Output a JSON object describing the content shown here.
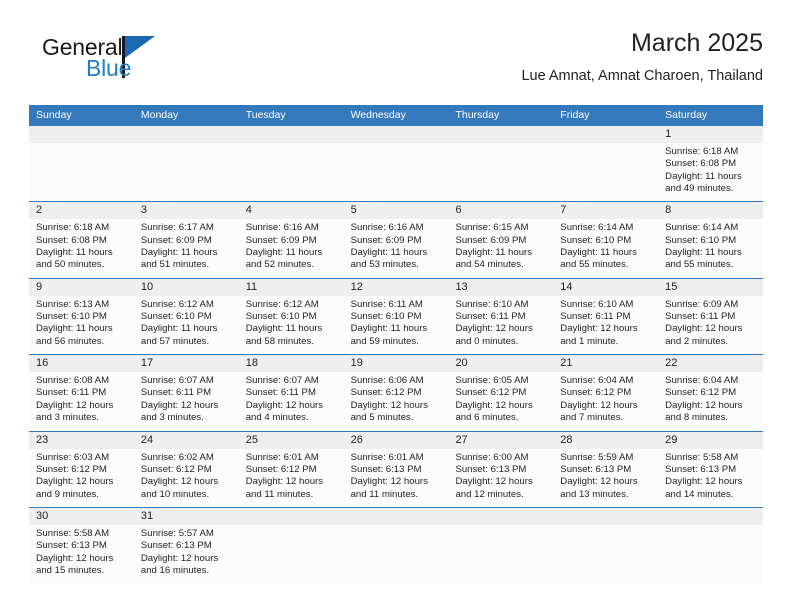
{
  "brand": {
    "name_top": "General",
    "name_bottom": "Blue",
    "accent_color": "#1f7fc4"
  },
  "header": {
    "title": "March 2025",
    "subtitle": "Lue Amnat, Amnat Charoen, Thailand"
  },
  "calendar": {
    "header_bg": "#3579bd",
    "date_band_bg": "#efefef",
    "weekdays": [
      "Sunday",
      "Monday",
      "Tuesday",
      "Wednesday",
      "Thursday",
      "Friday",
      "Saturday"
    ],
    "weeks": [
      [
        {
          "day": "",
          "lines": []
        },
        {
          "day": "",
          "lines": []
        },
        {
          "day": "",
          "lines": []
        },
        {
          "day": "",
          "lines": []
        },
        {
          "day": "",
          "lines": []
        },
        {
          "day": "",
          "lines": []
        },
        {
          "day": "1",
          "lines": [
            "Sunrise: 6:18 AM",
            "Sunset: 6:08 PM",
            "Daylight: 11 hours",
            "and 49 minutes."
          ]
        }
      ],
      [
        {
          "day": "2",
          "lines": [
            "Sunrise: 6:18 AM",
            "Sunset: 6:08 PM",
            "Daylight: 11 hours",
            "and 50 minutes."
          ]
        },
        {
          "day": "3",
          "lines": [
            "Sunrise: 6:17 AM",
            "Sunset: 6:09 PM",
            "Daylight: 11 hours",
            "and 51 minutes."
          ]
        },
        {
          "day": "4",
          "lines": [
            "Sunrise: 6:16 AM",
            "Sunset: 6:09 PM",
            "Daylight: 11 hours",
            "and 52 minutes."
          ]
        },
        {
          "day": "5",
          "lines": [
            "Sunrise: 6:16 AM",
            "Sunset: 6:09 PM",
            "Daylight: 11 hours",
            "and 53 minutes."
          ]
        },
        {
          "day": "6",
          "lines": [
            "Sunrise: 6:15 AM",
            "Sunset: 6:09 PM",
            "Daylight: 11 hours",
            "and 54 minutes."
          ]
        },
        {
          "day": "7",
          "lines": [
            "Sunrise: 6:14 AM",
            "Sunset: 6:10 PM",
            "Daylight: 11 hours",
            "and 55 minutes."
          ]
        },
        {
          "day": "8",
          "lines": [
            "Sunrise: 6:14 AM",
            "Sunset: 6:10 PM",
            "Daylight: 11 hours",
            "and 55 minutes."
          ]
        }
      ],
      [
        {
          "day": "9",
          "lines": [
            "Sunrise: 6:13 AM",
            "Sunset: 6:10 PM",
            "Daylight: 11 hours",
            "and 56 minutes."
          ]
        },
        {
          "day": "10",
          "lines": [
            "Sunrise: 6:12 AM",
            "Sunset: 6:10 PM",
            "Daylight: 11 hours",
            "and 57 minutes."
          ]
        },
        {
          "day": "11",
          "lines": [
            "Sunrise: 6:12 AM",
            "Sunset: 6:10 PM",
            "Daylight: 11 hours",
            "and 58 minutes."
          ]
        },
        {
          "day": "12",
          "lines": [
            "Sunrise: 6:11 AM",
            "Sunset: 6:10 PM",
            "Daylight: 11 hours",
            "and 59 minutes."
          ]
        },
        {
          "day": "13",
          "lines": [
            "Sunrise: 6:10 AM",
            "Sunset: 6:11 PM",
            "Daylight: 12 hours",
            "and 0 minutes."
          ]
        },
        {
          "day": "14",
          "lines": [
            "Sunrise: 6:10 AM",
            "Sunset: 6:11 PM",
            "Daylight: 12 hours",
            "and 1 minute."
          ]
        },
        {
          "day": "15",
          "lines": [
            "Sunrise: 6:09 AM",
            "Sunset: 6:11 PM",
            "Daylight: 12 hours",
            "and 2 minutes."
          ]
        }
      ],
      [
        {
          "day": "16",
          "lines": [
            "Sunrise: 6:08 AM",
            "Sunset: 6:11 PM",
            "Daylight: 12 hours",
            "and 3 minutes."
          ]
        },
        {
          "day": "17",
          "lines": [
            "Sunrise: 6:07 AM",
            "Sunset: 6:11 PM",
            "Daylight: 12 hours",
            "and 3 minutes."
          ]
        },
        {
          "day": "18",
          "lines": [
            "Sunrise: 6:07 AM",
            "Sunset: 6:11 PM",
            "Daylight: 12 hours",
            "and 4 minutes."
          ]
        },
        {
          "day": "19",
          "lines": [
            "Sunrise: 6:06 AM",
            "Sunset: 6:12 PM",
            "Daylight: 12 hours",
            "and 5 minutes."
          ]
        },
        {
          "day": "20",
          "lines": [
            "Sunrise: 6:05 AM",
            "Sunset: 6:12 PM",
            "Daylight: 12 hours",
            "and 6 minutes."
          ]
        },
        {
          "day": "21",
          "lines": [
            "Sunrise: 6:04 AM",
            "Sunset: 6:12 PM",
            "Daylight: 12 hours",
            "and 7 minutes."
          ]
        },
        {
          "day": "22",
          "lines": [
            "Sunrise: 6:04 AM",
            "Sunset: 6:12 PM",
            "Daylight: 12 hours",
            "and 8 minutes."
          ]
        }
      ],
      [
        {
          "day": "23",
          "lines": [
            "Sunrise: 6:03 AM",
            "Sunset: 6:12 PM",
            "Daylight: 12 hours",
            "and 9 minutes."
          ]
        },
        {
          "day": "24",
          "lines": [
            "Sunrise: 6:02 AM",
            "Sunset: 6:12 PM",
            "Daylight: 12 hours",
            "and 10 minutes."
          ]
        },
        {
          "day": "25",
          "lines": [
            "Sunrise: 6:01 AM",
            "Sunset: 6:12 PM",
            "Daylight: 12 hours",
            "and 11 minutes."
          ]
        },
        {
          "day": "26",
          "lines": [
            "Sunrise: 6:01 AM",
            "Sunset: 6:13 PM",
            "Daylight: 12 hours",
            "and 11 minutes."
          ]
        },
        {
          "day": "27",
          "lines": [
            "Sunrise: 6:00 AM",
            "Sunset: 6:13 PM",
            "Daylight: 12 hours",
            "and 12 minutes."
          ]
        },
        {
          "day": "28",
          "lines": [
            "Sunrise: 5:59 AM",
            "Sunset: 6:13 PM",
            "Daylight: 12 hours",
            "and 13 minutes."
          ]
        },
        {
          "day": "29",
          "lines": [
            "Sunrise: 5:58 AM",
            "Sunset: 6:13 PM",
            "Daylight: 12 hours",
            "and 14 minutes."
          ]
        }
      ],
      [
        {
          "day": "30",
          "lines": [
            "Sunrise: 5:58 AM",
            "Sunset: 6:13 PM",
            "Daylight: 12 hours",
            "and 15 minutes."
          ]
        },
        {
          "day": "31",
          "lines": [
            "Sunrise: 5:57 AM",
            "Sunset: 6:13 PM",
            "Daylight: 12 hours",
            "and 16 minutes."
          ]
        },
        {
          "day": "",
          "lines": []
        },
        {
          "day": "",
          "lines": []
        },
        {
          "day": "",
          "lines": []
        },
        {
          "day": "",
          "lines": []
        },
        {
          "day": "",
          "lines": []
        }
      ]
    ]
  }
}
